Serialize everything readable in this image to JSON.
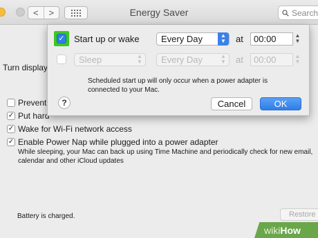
{
  "window": {
    "title": "Energy Saver",
    "search_placeholder": "Search",
    "nav_back": "<",
    "nav_forward": ">"
  },
  "pane": {
    "turn_display_label": "Turn display",
    "options": [
      {
        "label": "Prevent",
        "checked": false
      },
      {
        "label": "Put hard",
        "checked": true
      },
      {
        "label": "Wake for Wi-Fi network access",
        "checked": true
      },
      {
        "label": "Enable Power Nap while plugged into a power adapter",
        "checked": true
      }
    ],
    "power_nap_desc_1": "While sleeping, your Mac can back up using Time Machine and periodically check for new email,",
    "power_nap_desc_2": "calendar and other iCloud updates",
    "battery_status": "Battery is charged.",
    "restore_label": "Restore"
  },
  "sheet": {
    "row1": {
      "checked": true,
      "action": "Start up or wake",
      "schedule": "Every Day",
      "at": "at",
      "time": "00:00"
    },
    "row2": {
      "checked": false,
      "action": "Sleep",
      "schedule": "Every Day",
      "at": "at",
      "time": "00:00"
    },
    "note_line1": "Scheduled start up will only occur when a power adapter is",
    "note_line2": "connected to your Mac.",
    "help": "?",
    "cancel_label": "Cancel",
    "ok_label": "OK"
  },
  "watermark": {
    "wiki": "wiki",
    "how": "How"
  },
  "colors": {
    "accent": "#2f7fe6",
    "highlight": "#3cc81e",
    "watermark": "#6aa64a"
  }
}
